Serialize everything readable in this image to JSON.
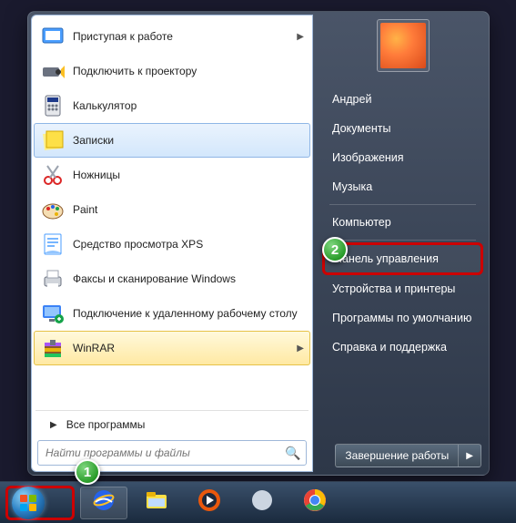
{
  "user_name": "Андрей",
  "programs": [
    {
      "label": "Приступая к работе",
      "icon": "getting-started",
      "expand": true
    },
    {
      "label": "Подключить к проектору",
      "icon": "projector"
    },
    {
      "label": "Калькулятор",
      "icon": "calculator"
    },
    {
      "label": "Записки",
      "icon": "sticky-notes",
      "hovered": true
    },
    {
      "label": "Ножницы",
      "icon": "snipping"
    },
    {
      "label": "Paint",
      "icon": "paint"
    },
    {
      "label": "Средство просмотра XPS",
      "icon": "xps"
    },
    {
      "label": "Факсы и сканирование Windows",
      "icon": "fax"
    },
    {
      "label": "Подключение к удаленному рабочему столу",
      "icon": "remote"
    },
    {
      "label": "WinRAR",
      "icon": "winrar",
      "expand": true,
      "selected": true
    }
  ],
  "all_programs_label": "Все программы",
  "search_placeholder": "Найти программы и файлы",
  "right_items": [
    {
      "label": "Андрей"
    },
    {
      "label": "Документы"
    },
    {
      "label": "Изображения"
    },
    {
      "label": "Музыка"
    },
    {
      "sep": true
    },
    {
      "label": "Компьютер"
    },
    {
      "sep": true
    },
    {
      "label": "Панель управления",
      "highlight": true
    },
    {
      "label": "Устройства и принтеры"
    },
    {
      "label": "Программы по умолчанию"
    },
    {
      "label": "Справка и поддержка"
    }
  ],
  "shutdown_label": "Завершение работы",
  "callouts": {
    "c1": "1",
    "c2": "2"
  },
  "taskbar_icons": [
    "ie",
    "explorer",
    "media-player",
    "unknown",
    "chrome"
  ]
}
